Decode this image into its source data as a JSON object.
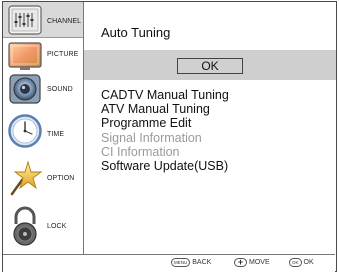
{
  "sidebar": {
    "items": [
      {
        "label": "CHANNEL",
        "icon": "channel-icon"
      },
      {
        "label": "PICTURE",
        "icon": "picture-icon"
      },
      {
        "label": "SOUND",
        "icon": "sound-icon"
      },
      {
        "label": "TIME",
        "icon": "clock-icon"
      },
      {
        "label": "OPTION",
        "icon": "star-icon"
      },
      {
        "label": "LOCK",
        "icon": "lock-icon"
      }
    ],
    "active_index": 0
  },
  "main": {
    "title": "Auto Tuning",
    "ok_label": "OK",
    "menu_items": [
      {
        "label": "CADTV Manual Tuning",
        "enabled": true
      },
      {
        "label": "ATV Manual Tuning",
        "enabled": true
      },
      {
        "label": "Programme Edit",
        "enabled": true
      },
      {
        "label": "Signal Information",
        "enabled": false
      },
      {
        "label": "CI Information",
        "enabled": false
      },
      {
        "label": "Software Update(USB)",
        "enabled": true
      }
    ]
  },
  "footer": {
    "back_key": "MENU",
    "back_label": "BACK",
    "move_key": "+",
    "move_label": "MOVE",
    "ok_key": "OK",
    "ok_label": "OK"
  },
  "colors": {
    "highlight_band": "#cfcfcf",
    "disabled_text": "#9a9a9a",
    "frame": "#4a4a4a"
  }
}
